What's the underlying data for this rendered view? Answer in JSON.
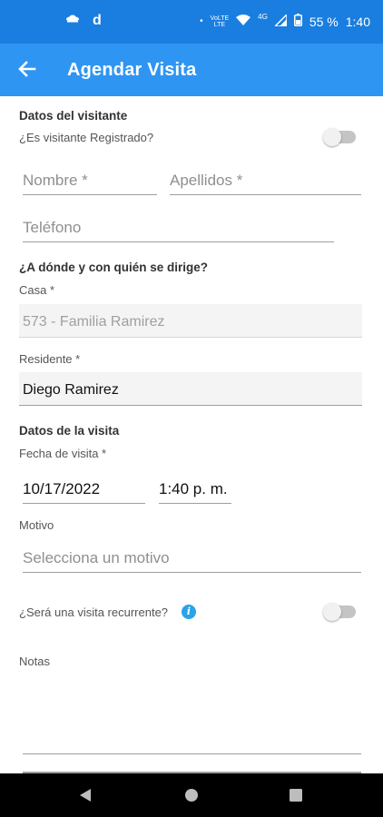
{
  "status_bar": {
    "time": "1:40",
    "battery": "55 %",
    "net_top": "VoLTE",
    "net_bottom": "LTE",
    "signal_label": "4G",
    "notif_letter": "d",
    "dot": "•"
  },
  "app_bar": {
    "title": "Agendar Visita",
    "back_icon": "arrow-left-icon"
  },
  "visitor": {
    "section": "Datos del visitante",
    "registered_question": "¿Es visitante Registrado?",
    "registered_on": false,
    "first_name_placeholder": "Nombre *",
    "last_name_placeholder": "Apellidos *",
    "phone_placeholder": "Teléfono"
  },
  "destination": {
    "section": "¿A dónde y con quién se dirige?",
    "house_label": "Casa *",
    "house_value": "573 - Familia Ramirez",
    "resident_label": "Residente *",
    "resident_value": "Diego Ramirez"
  },
  "visit": {
    "section": "Datos de la visita",
    "date_label": "Fecha de visita *",
    "date_value": "10/17/2022",
    "time_value": "1:40 p. m.",
    "reason_label": "Motivo",
    "reason_placeholder": "Selecciona un motivo",
    "recurring_question": "¿Será una visita recurrente?",
    "recurring_on": false,
    "info_glyph": "i",
    "notes_label": "Notas"
  },
  "nav_bar": {
    "back": "triangle-back-icon",
    "home": "circle-home-icon",
    "recents": "square-recents-icon"
  }
}
